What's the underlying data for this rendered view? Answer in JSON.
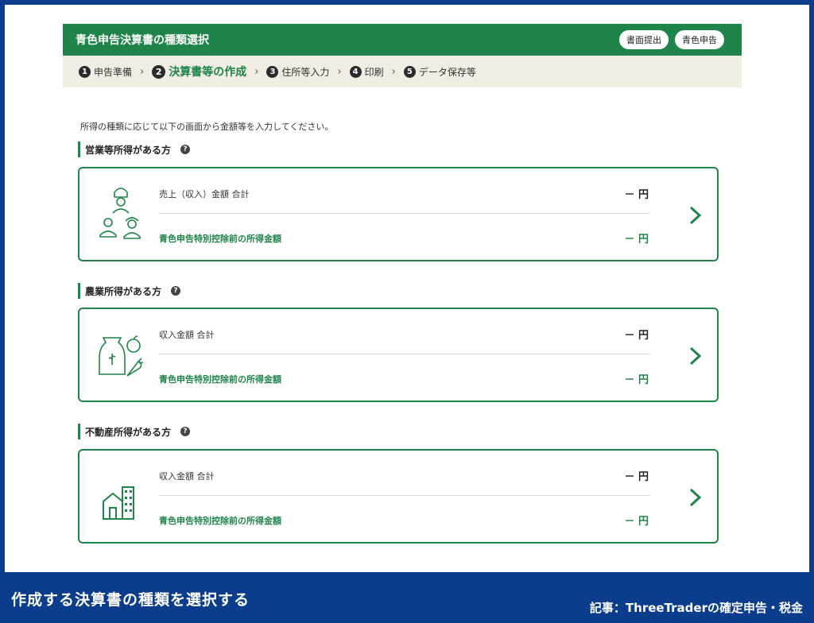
{
  "header": {
    "title": "青色申告決算書の種類選択",
    "pills": [
      "書面提出",
      "青色申告"
    ]
  },
  "steps": [
    {
      "num": "1",
      "label": "申告準備",
      "active": false
    },
    {
      "num": "2",
      "label": "決算書等の作成",
      "active": true
    },
    {
      "num": "3",
      "label": "住所等入力",
      "active": false
    },
    {
      "num": "4",
      "label": "印刷",
      "active": false
    },
    {
      "num": "5",
      "label": "データ保存等",
      "active": false
    }
  ],
  "step_separator": "›",
  "intro": "所得の種類に応じて以下の画面から金額等を入力してください。",
  "help_glyph": "?",
  "sections": [
    {
      "heading": "営業等所得がある方",
      "icon": "workers-icon",
      "row1_label": "売上（収入）金額 合計",
      "row1_value": "－ 円",
      "row2_label": "青色申告特別控除前の所得金額",
      "row2_value": "－ 円"
    },
    {
      "heading": "農業所得がある方",
      "icon": "produce-icon",
      "row1_label": "収入金額 合計",
      "row1_value": "－ 円",
      "row2_label": "青色申告特別控除前の所得金額",
      "row2_value": "－ 円"
    },
    {
      "heading": "不動産所得がある方",
      "icon": "building-icon",
      "row1_label": "収入金額 合計",
      "row1_value": "－ 円",
      "row2_label": "青色申告特別控除前の所得金額",
      "row2_value": "－ 円"
    }
  ],
  "caption": {
    "left": "作成する決算書の種類を選択する",
    "right": "記事：ThreeTraderの確定申告・税金"
  },
  "colors": {
    "accent": "#1e8449",
    "frame": "#0c3d8c",
    "stepbar": "#f1ede4"
  }
}
